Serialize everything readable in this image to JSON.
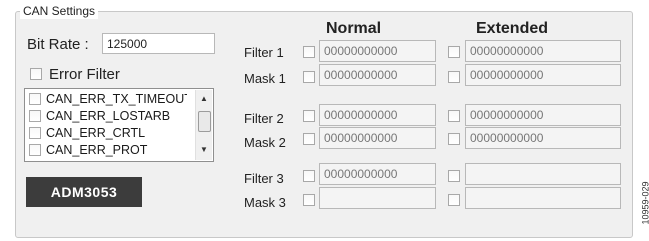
{
  "group_title": "CAN Settings",
  "bit_rate": {
    "label": "Bit Rate :",
    "value": "125000"
  },
  "error_filter": {
    "label": "Error Filter",
    "checked": false
  },
  "error_list": {
    "items": [
      {
        "label": "CAN_ERR_TX_TIMEOUT",
        "checked": false
      },
      {
        "label": "CAN_ERR_LOSTARB",
        "checked": false
      },
      {
        "label": "CAN_ERR_CRTL",
        "checked": false
      },
      {
        "label": "CAN_ERR_PROT",
        "checked": false
      }
    ]
  },
  "brand_label": "ADM3053",
  "headers": {
    "normal": "Normal",
    "extended": "Extended"
  },
  "rows": {
    "filter1": {
      "label": "Filter 1",
      "normal": "00000000000",
      "extended": "00000000000"
    },
    "mask1": {
      "label": "Mask 1",
      "normal": "00000000000",
      "extended": "00000000000"
    },
    "filter2": {
      "label": "Filter 2",
      "normal": "00000000000",
      "extended": "00000000000"
    },
    "mask2": {
      "label": "Mask 2",
      "normal": "00000000000",
      "extended": "00000000000"
    },
    "filter3": {
      "label": "Filter 3",
      "normal": "00000000000",
      "extended": ""
    },
    "mask3": {
      "label": "Mask 3",
      "normal": "",
      "extended": ""
    }
  },
  "figure_id": "10959-029"
}
